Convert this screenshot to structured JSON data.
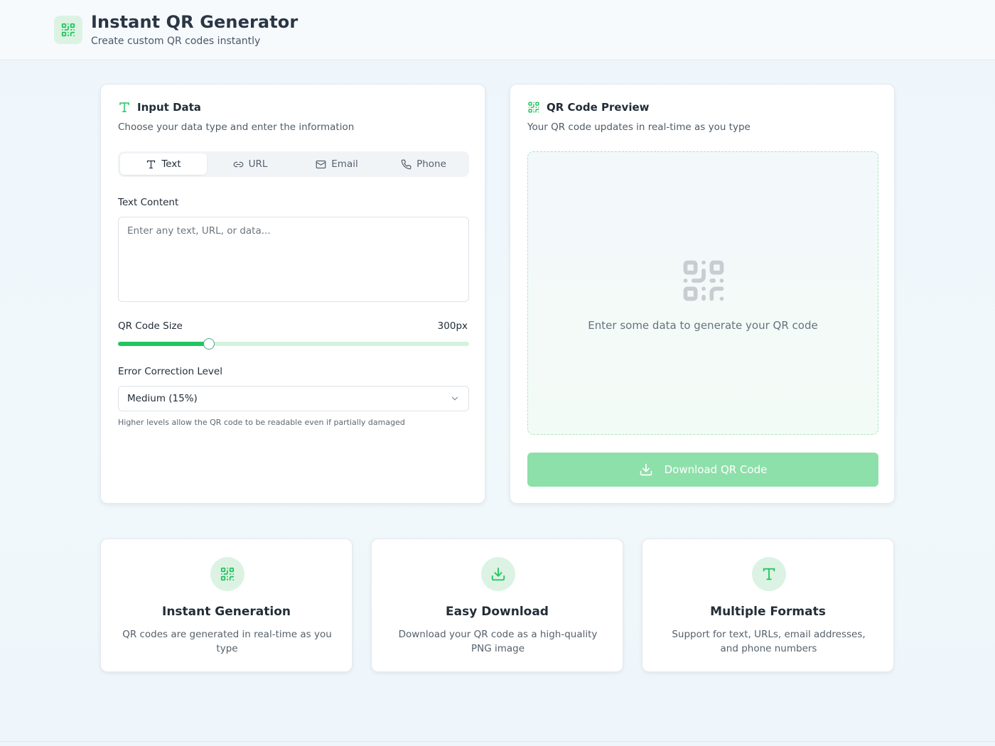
{
  "header": {
    "title": "Instant QR Generator",
    "subtitle": "Create custom QR codes instantly",
    "logo_icon": "qr-code-icon"
  },
  "input_card": {
    "title": "Input Data",
    "title_icon": "text-type-icon",
    "description": "Choose your data type and enter the information",
    "tabs": [
      {
        "label": "Text",
        "icon": "text-type-icon",
        "active": true
      },
      {
        "label": "URL",
        "icon": "link-icon",
        "active": false
      },
      {
        "label": "Email",
        "icon": "mail-icon",
        "active": false
      },
      {
        "label": "Phone",
        "icon": "phone-icon",
        "active": false
      }
    ],
    "text_label": "Text Content",
    "text_placeholder": "Enter any text, URL, or data...",
    "text_value": "",
    "size_label": "QR Code Size",
    "size_value": "300px",
    "size_slider_fraction": 0.26,
    "ecl_label": "Error Correction Level",
    "ecl_selected": "Medium (15%)",
    "ecl_hint": "Higher levels allow the QR code to be readable even if partially damaged"
  },
  "preview_card": {
    "title": "QR Code Preview",
    "title_icon": "qr-code-icon",
    "description": "Your QR code updates in real-time as you type",
    "empty_message": "Enter some data to generate your QR code",
    "download_label": "Download QR Code",
    "download_icon": "download-icon"
  },
  "features": [
    {
      "title": "Instant Generation",
      "description": "QR codes are generated in real-time as you type",
      "icon": "qr-code-icon"
    },
    {
      "title": "Easy Download",
      "description": "Download your QR code as a high-quality PNG image",
      "icon": "download-icon"
    },
    {
      "title": "Multiple Formats",
      "description": "Support for text, URLs, email addresses, and phone numbers",
      "icon": "text-type-icon"
    }
  ],
  "colors": {
    "accent": "#22c55e",
    "accent_soft": "#dcf3e4",
    "download_disabled": "#8de0a9",
    "slider_track": "#d4f2de"
  }
}
